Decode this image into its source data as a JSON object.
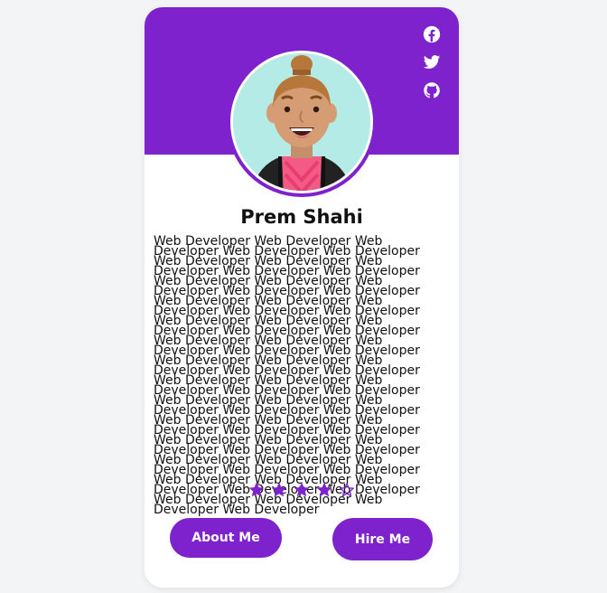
{
  "profile": {
    "name": "Prem Shahi",
    "bio": "Web Developer Web Developer Web Developer Web Developer Web Developer Web Developer Web Developer Web Developer Web Developer Web Developer Web Developer Web Developer Web Developer Web Developer Web Developer Web Developer Web Developer Web Developer Web Developer Web Developer Web Developer Web Developer Web Developer Web Developer Web Developer Web Developer Web Developer Web Developer Web Developer Web Developer Web Developer Web Developer Web Developer Web Developer Web Developer Web Developer Web Developer Web Developer Web Developer Web Developer Web Developer Web Developer Web Developer Web Developer Web Developer Web Developer Web Developer Web Developer Web Developer Web Developer Web Developer Web Developer Web Developer Web Developer Web Developer Web Developer Web Developer Web Developer Web Developer Web Developer Web Developer Web Developer Web Developer Web Developer Web Developer Web Developer Web Developer Web Developer Web Developer"
  },
  "socials": [
    {
      "icon": "facebook-icon"
    },
    {
      "icon": "twitter-icon"
    },
    {
      "icon": "github-icon"
    }
  ],
  "rating": {
    "value": 4,
    "max": 5
  },
  "buttons": {
    "about_label": "About Me",
    "hire_label": "Hire Me"
  },
  "colors": {
    "accent": "#7e22ce",
    "background": "#f3f4f6",
    "card": "#ffffff",
    "avatar_bg": "#b5ebe6"
  }
}
